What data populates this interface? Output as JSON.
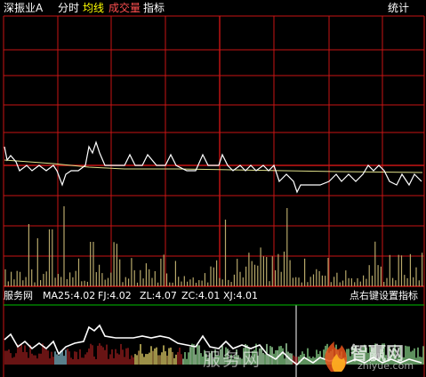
{
  "colors": {
    "background": "#000000",
    "grid_red": "#c81414",
    "price_line": "#ffffff",
    "avg_line": "#e0e08a",
    "volume": "#b7a86a",
    "indicator_border": "#00c000",
    "title_white": "#ffffff",
    "tab_yellow": "#ffff00",
    "tab_red": "#ff5050"
  },
  "header": {
    "stock_name": "深振业A",
    "tabs": [
      {
        "label": "分时",
        "color": "#ffffff"
      },
      {
        "label": "均线",
        "color": "#ffff00"
      },
      {
        "label": "成交量",
        "color": "#ff5050"
      },
      {
        "label": "指标",
        "color": "#ffffff"
      }
    ],
    "right_label": "统计"
  },
  "indicator": {
    "name": "服务网",
    "values": [
      {
        "text": "MA25:4.02",
        "color": "#ffffff"
      },
      {
        "text": "FJ:4.02",
        "color": "#ffffff"
      },
      {
        "text": "ZL:4.07",
        "color": "#ffffff"
      },
      {
        "text": "ZC:4.01",
        "color": "#ffffff"
      },
      {
        "text": "XJ:4.01",
        "color": "#ffffff"
      }
    ],
    "settings_label": "点右键设置指标"
  },
  "watermark": {
    "text_cn": "服务网",
    "brand_cn": "智赢网",
    "url": "zhiyue.com",
    "icon": "flame-icon"
  }
}
